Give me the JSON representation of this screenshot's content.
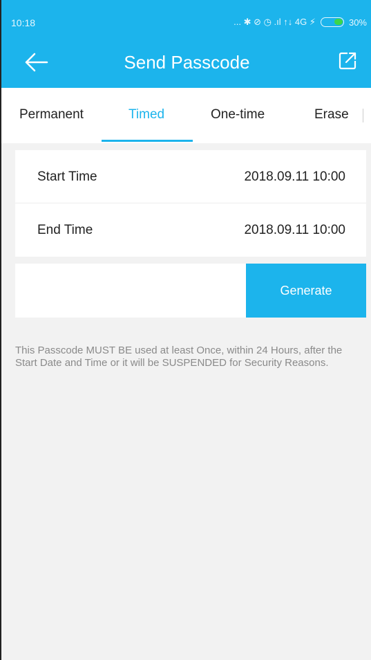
{
  "status_bar": {
    "time": "10:18",
    "indicators": "... ✱ ⊘ ◷ .ıl ↑↓ 4G ⚡",
    "battery_percent": "30%"
  },
  "header": {
    "title": "Send Passcode",
    "back_icon": "arrow-left-icon",
    "share_icon": "external-share-icon"
  },
  "tabs": [
    {
      "label": "Permanent",
      "active": false
    },
    {
      "label": "Timed",
      "active": true
    },
    {
      "label": "One-time",
      "active": false
    },
    {
      "label": "Erase",
      "active": false
    }
  ],
  "form": {
    "start_time_label": "Start Time",
    "start_time_value": "2018.09.11 10:00",
    "end_time_label": "End Time",
    "end_time_value": "2018.09.11 10:00"
  },
  "generate_label": "Generate",
  "note": "This Passcode MUST BE used at least Once, within 24 Hours, after the Start Date and Time or it will be SUSPENDED for Security Reasons.",
  "colors": {
    "accent": "#1cb4ec",
    "background": "#f2f2f2",
    "note_text": "#8a8a8a"
  }
}
